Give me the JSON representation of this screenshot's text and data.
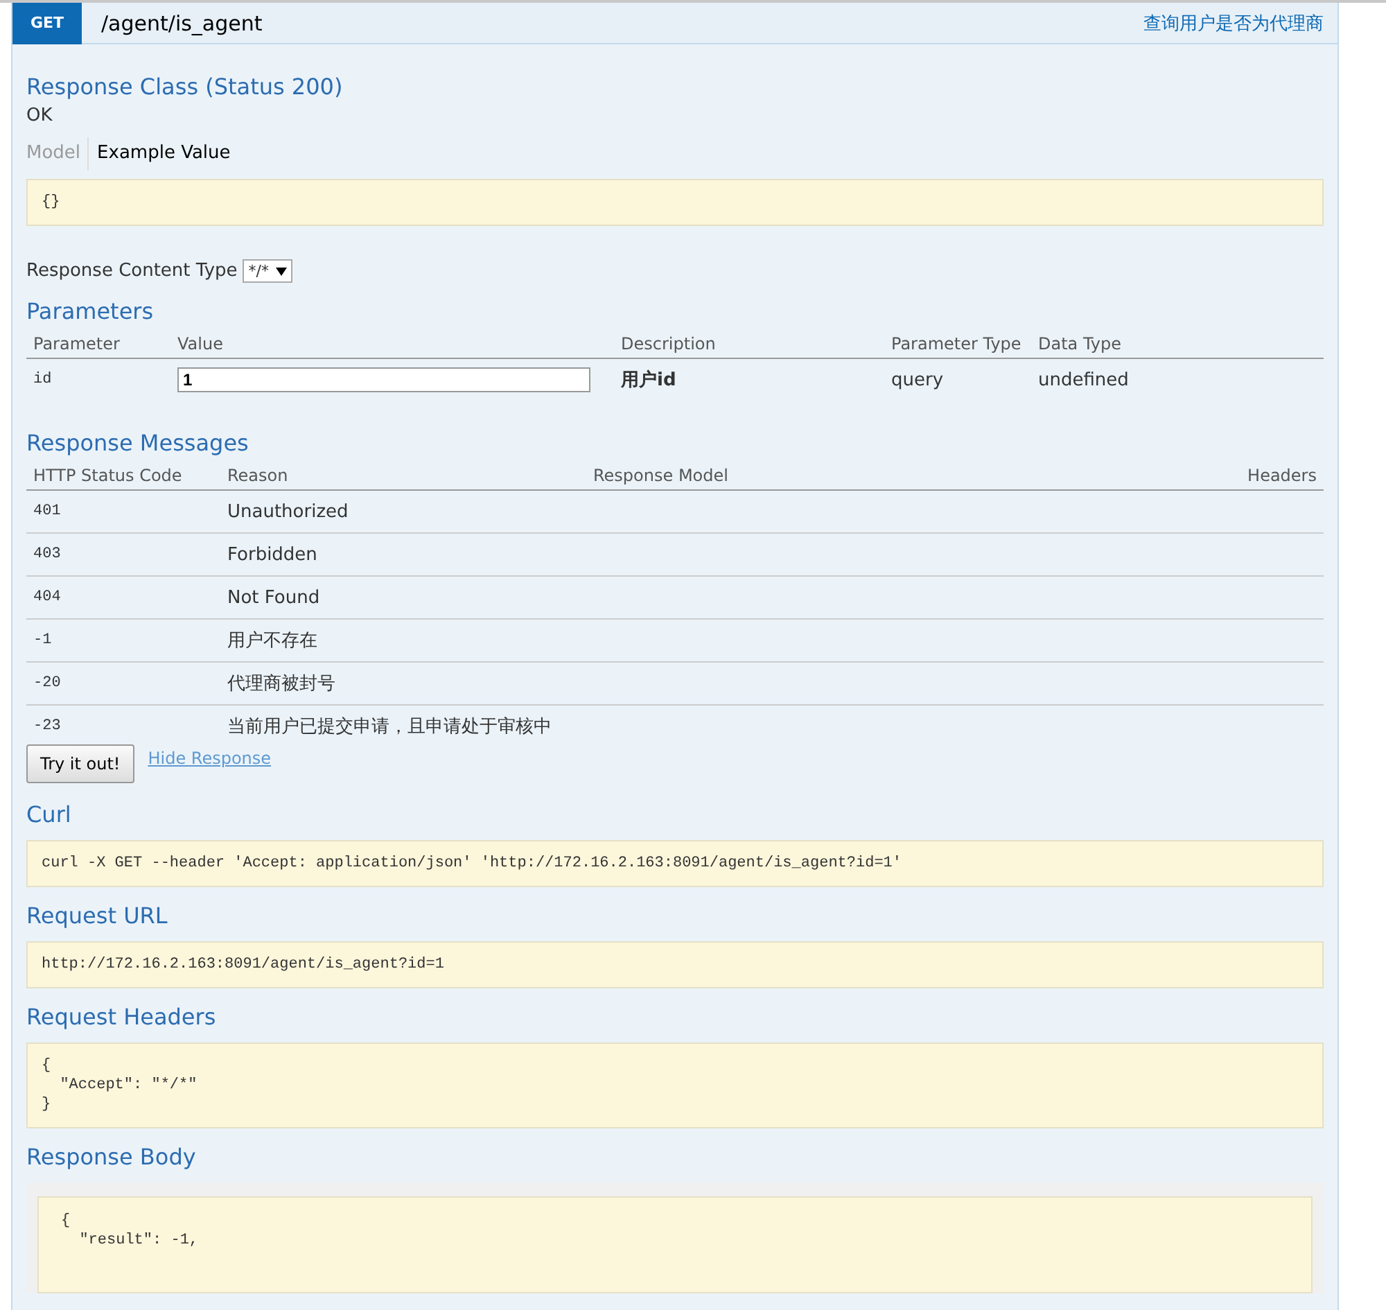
{
  "operation": {
    "method": "GET",
    "path": "/agent/is_agent",
    "summary": "查询用户是否为代理商",
    "response_class": {
      "title": "Response Class (Status 200)",
      "description": "OK",
      "tabs": [
        {
          "label": "Model",
          "selected": false
        },
        {
          "label": "Example Value",
          "selected": true
        }
      ],
      "example": "{}"
    },
    "response_content_type": {
      "label": "Response Content Type",
      "value": "*/*"
    },
    "parameters": {
      "title": "Parameters",
      "columns": [
        "Parameter",
        "Value",
        "Description",
        "Parameter Type",
        "Data Type"
      ],
      "rows": [
        {
          "parameter": "id",
          "value": "1",
          "description": "用户id",
          "parameter_type": "query",
          "data_type": "undefined"
        }
      ]
    },
    "response_messages": {
      "title": "Response Messages",
      "columns": [
        "HTTP Status Code",
        "Reason",
        "Response Model",
        "Headers"
      ],
      "rows": [
        {
          "code": "401",
          "reason": "Unauthorized"
        },
        {
          "code": "403",
          "reason": "Forbidden"
        },
        {
          "code": "404",
          "reason": "Not Found"
        },
        {
          "code": "-1",
          "reason": "用户不存在"
        },
        {
          "code": "-20",
          "reason": "代理商被封号"
        },
        {
          "code": "-23",
          "reason": "当前用户已提交申请，且申请处于审核中"
        }
      ]
    },
    "try_button": "Try it out!",
    "hide_link": "Hide Response",
    "sections": [
      {
        "title": "Curl",
        "kind": "plain",
        "code": "curl -X GET --header 'Accept: application/json' 'http://172.16.2.163:8091/agent/is_agent?id=1'"
      },
      {
        "title": "Request URL",
        "kind": "plain",
        "code": "http://172.16.2.163:8091/agent/is_agent?id=1"
      },
      {
        "title": "Request Headers",
        "kind": "plain",
        "code": "{\n  \"Accept\": \"*/*\"\n}"
      },
      {
        "title": "Response Body",
        "kind": "framed",
        "code": "{\n  \"result\": -1,"
      }
    ]
  }
}
